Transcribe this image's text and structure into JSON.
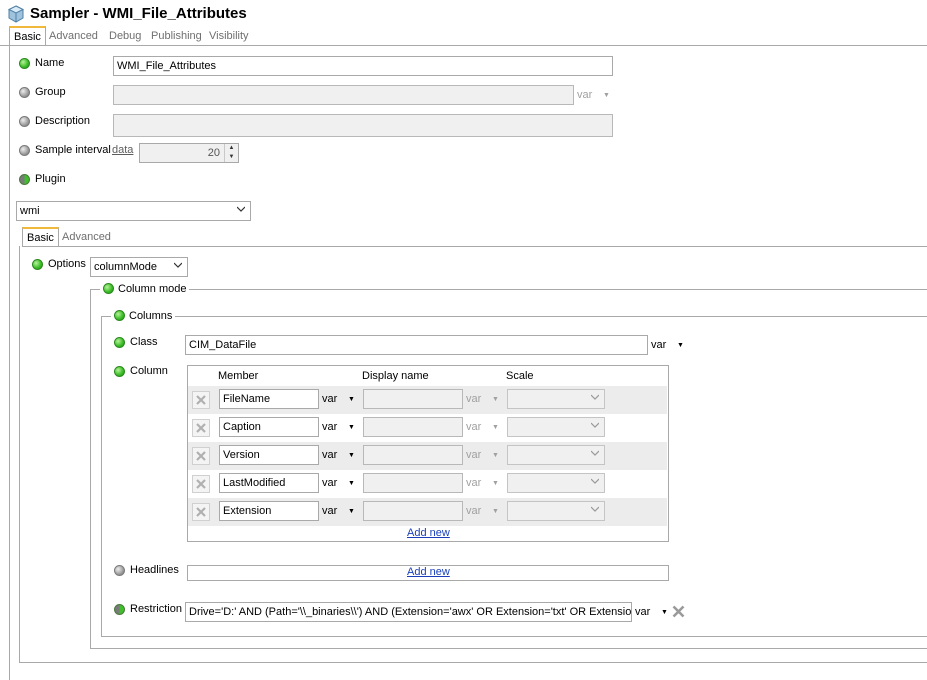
{
  "window": {
    "title": "Sampler - WMI_File_Attributes",
    "icon": "cube-icon"
  },
  "top_tabs": [
    "Basic",
    "Advanced",
    "Debug",
    "Publishing",
    "Visibility"
  ],
  "fields": {
    "name": {
      "label": "Name",
      "value": "WMI_File_Attributes"
    },
    "group": {
      "label": "Group",
      "value": "",
      "var": "var"
    },
    "description": {
      "label": "Description",
      "value": ""
    },
    "sample_interval": {
      "label": "Sample interval",
      "link": "data",
      "value": "20"
    },
    "plugin": {
      "label": "Plugin",
      "value": "wmi"
    }
  },
  "plugin_tabs": [
    "Basic",
    "Advanced"
  ],
  "options": {
    "label": "Options",
    "value": "columnMode"
  },
  "column_mode": {
    "title": "Column mode"
  },
  "columns": {
    "title": "Columns",
    "class": {
      "label": "Class",
      "value": "CIM_DataFile",
      "var": "var"
    },
    "column": {
      "label": "Column",
      "headers": {
        "member": "Member",
        "display_name": "Display name",
        "scale": "Scale"
      },
      "rows": [
        {
          "member": "FileName",
          "var": "var",
          "display_var": "var"
        },
        {
          "member": "Caption",
          "var": "var",
          "display_var": "var"
        },
        {
          "member": "Version",
          "var": "var",
          "display_var": "var"
        },
        {
          "member": "LastModified",
          "var": "var",
          "display_var": "var"
        },
        {
          "member": "Extension",
          "var": "var",
          "display_var": "var"
        }
      ],
      "add_new": "Add new"
    }
  },
  "headlines": {
    "label": "Headlines",
    "add_new": "Add new"
  },
  "restriction": {
    "label": "Restriction",
    "value": "Drive='D:' AND (Path='\\\\_binaries\\\\') AND (Extension='awx' OR Extension='txt' OR Extension='dll')",
    "var": "var"
  },
  "colors": {
    "accent_tab": "#f0b93c",
    "status_green": "#3fbf2b",
    "link": "#1a3fb8"
  }
}
